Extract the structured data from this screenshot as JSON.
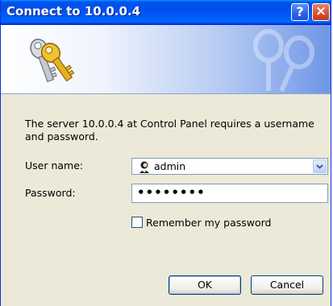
{
  "window": {
    "title": "Connect to 10.0.0.4",
    "help_label": "?",
    "close_label": "×"
  },
  "banner": {
    "icon": "keys-icon"
  },
  "form": {
    "message": "The server 10.0.0.4 at Control Panel requires a username and password.",
    "username_label": "User name:",
    "username_value": "admin",
    "password_label": "Password:",
    "password_value": "••••••••",
    "remember_label": "Remember my password",
    "remember_checked": false
  },
  "buttons": {
    "ok_label": "OK",
    "cancel_label": "Cancel"
  },
  "colors": {
    "titlebar": "#0054e3",
    "dialog_bg": "#ece9d8",
    "close_button": "#d8502f"
  }
}
